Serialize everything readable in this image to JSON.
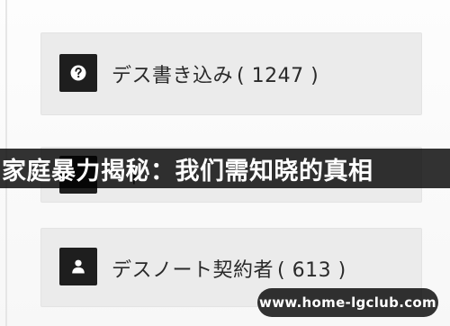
{
  "items": [
    {
      "icon": "question-icon",
      "label": "デス書き込み",
      "count": "( 1247 )"
    },
    {
      "icon": "unknown-icon",
      "partial_text": "ト"
    },
    {
      "icon": "user-icon",
      "label": "デスノート契約者",
      "count": "( 613 )"
    }
  ],
  "banner": {
    "text": "家庭暴力揭秘：我们需知晓的真相"
  },
  "watermark": {
    "text": "www.home-lgclub.com"
  },
  "colors": {
    "card_bg": "#ebebeb",
    "icon_bg": "#1e1e1e",
    "overlay": "#000000"
  }
}
